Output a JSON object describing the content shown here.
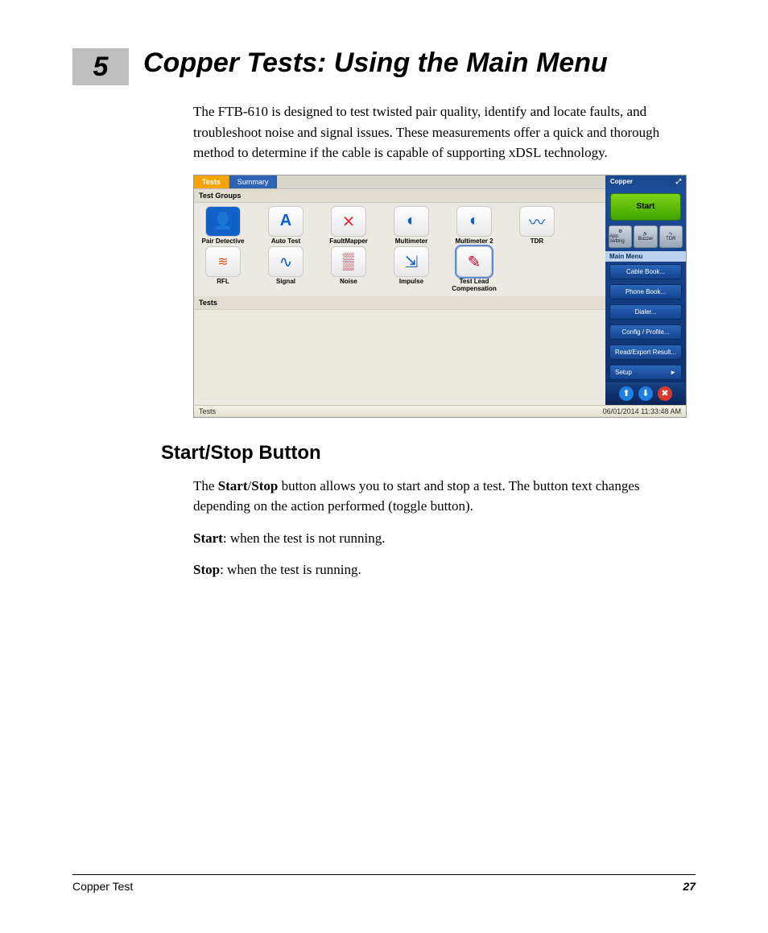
{
  "chapter": {
    "number": "5",
    "title": "Copper Tests: Using the Main Menu"
  },
  "intro": "The FTB-610 is designed to test twisted pair quality, identify and locate faults, and troubleshoot noise and signal issues. These measurements offer a quick and thorough method to determine if the cable is capable of supporting xDSL technology.",
  "section": {
    "heading": "Start/Stop Button",
    "para_lead_bold": "Start",
    "para_lead_sep": "/",
    "para_lead_bold2": "Stop",
    "para_rest": " button allows you to start and stop a test. The button text changes depending on the action performed (toggle button).",
    "para_pre": "The ",
    "start_label": "Start",
    "start_text": ": when the test is not running.",
    "stop_label": "Stop",
    "stop_text": ": when the test is running."
  },
  "footer": {
    "left": "Copper Test",
    "page": "27"
  },
  "screenshot": {
    "tabs": {
      "active": "Tests",
      "inactive": "Summary"
    },
    "test_groups_label": "Test Groups",
    "tests_label": "Tests",
    "groups_row1": [
      {
        "name": "Pair Detective",
        "glyph": "👤"
      },
      {
        "name": "Auto Test",
        "glyph": "A"
      },
      {
        "name": "FaultMapper",
        "glyph": "⨯"
      },
      {
        "name": "Multimeter",
        "glyph": "◐"
      },
      {
        "name": "Multimeter 2",
        "glyph": "◐"
      },
      {
        "name": "TDR",
        "glyph": "〰"
      }
    ],
    "groups_row2": [
      {
        "name": "RFL",
        "glyph": "≋"
      },
      {
        "name": "Signal",
        "glyph": "∿"
      },
      {
        "name": "Noise",
        "glyph": "▒"
      },
      {
        "name": "Impulse",
        "glyph": "⇲"
      },
      {
        "name": "Test Lead Compensation",
        "glyph": "✎"
      }
    ],
    "side": {
      "title": "Copper",
      "start": "Start",
      "tools": [
        "App. Setting",
        "Buzzer",
        "TDR"
      ],
      "menu_header": "Main Menu",
      "menu": [
        "Cable Book...",
        "Phone Book...",
        "Dialer...",
        "Config / Profile...",
        "Read/Export Result..."
      ],
      "setup": "Setup",
      "arrow": "►"
    },
    "status": {
      "left": "Tests",
      "right": "06/01/2014 11:33:48 AM"
    }
  }
}
